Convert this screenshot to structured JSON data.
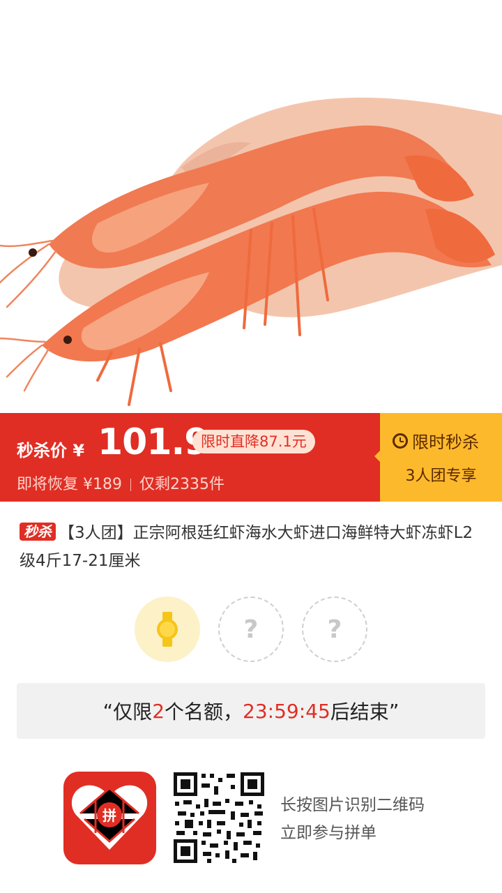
{
  "price_banner": {
    "label": "秒杀价 ¥",
    "price": "101.9",
    "discount": "限时直降87.1元",
    "original_price": "即将恢复 ¥189",
    "remaining": "仅剩2335件",
    "flash_title": "限时秒杀",
    "flash_sub": "3人团专享",
    "colors": {
      "red": "#e02e24",
      "yellow": "#fdb92c"
    }
  },
  "product": {
    "badge": "秒杀",
    "title": "【3人团】正宗阿根廷红虾海水大虾进口海鲜特大虾冻虾L2级4斤17-21厘米"
  },
  "group": {
    "placeholder_mark": "?",
    "leader_icon": "watch-icon"
  },
  "quota": {
    "open_quote": "“",
    "prefix": "仅限",
    "count": "2",
    "middle": "个名额，",
    "countdown": "23:59:45",
    "suffix": "后结束",
    "close_quote": "”"
  },
  "footer": {
    "line1": "长按图片识别二维码",
    "line2": "立即参与拼单",
    "logo_text": "拼"
  }
}
